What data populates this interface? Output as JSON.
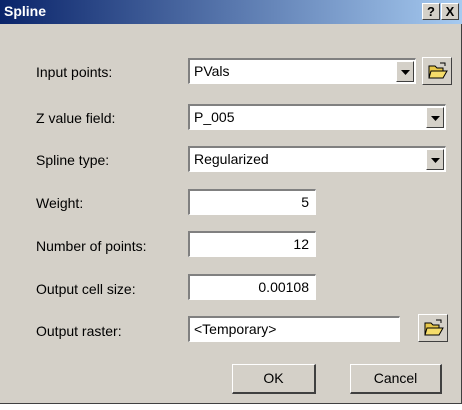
{
  "window": {
    "title": "Spline",
    "help_label": "?",
    "close_label": "X"
  },
  "fields": {
    "input_points": {
      "label": "Input points:",
      "value": "PVals"
    },
    "z_value_field": {
      "label": "Z value field:",
      "value": "P_005"
    },
    "spline_type": {
      "label": "Spline type:",
      "value": "Regularized"
    },
    "weight": {
      "label": "Weight:",
      "value": "5"
    },
    "number_of_points": {
      "label": "Number of points:",
      "value": "12"
    },
    "output_cell_size": {
      "label": "Output cell size:",
      "value": "0.00108"
    },
    "output_raster": {
      "label": "Output raster:",
      "value": "<Temporary>"
    }
  },
  "buttons": {
    "ok": "OK",
    "cancel": "Cancel"
  },
  "icons": {
    "dropdown": "chevron-down-icon",
    "browse": "open-folder-icon"
  },
  "colors": {
    "title_start": "#0a246a",
    "title_end": "#a6caf0",
    "dialog_bg": "#d4d0c8"
  }
}
